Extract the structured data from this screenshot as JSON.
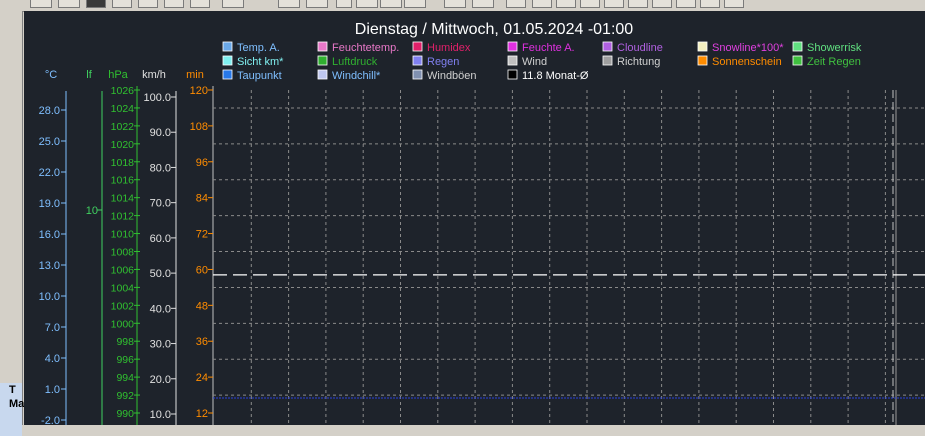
{
  "window": {
    "side_label_1": "T",
    "side_label_2": "Ma"
  },
  "toolbar": {
    "buttons": [
      "nav-first",
      "nav-prev",
      "record",
      "open",
      "table",
      "minus",
      "doc",
      "grid",
      "back",
      "forward",
      "new",
      "box1",
      "box2",
      "box3",
      "tbl1",
      "tbl2",
      "b1",
      "b2",
      "b3",
      "b4",
      "b5",
      "b6",
      "b7",
      "b8",
      "b9",
      "b10"
    ]
  },
  "chart_data": {
    "type": "line",
    "title": "Dienstag / Mittwoch, 01.05.2024  -01:00",
    "axes": [
      {
        "name": "°C",
        "color": "#7fbfff",
        "ticks": [
          "28.0",
          "25.0",
          "22.0",
          "19.0",
          "16.0",
          "13.0",
          "10.0",
          "7.0",
          "4.0",
          "1.0",
          "-2.0"
        ],
        "range": [
          -2.0,
          28.0
        ]
      },
      {
        "name": "lf",
        "color": "#40d060",
        "ticks": [
          "10"
        ]
      },
      {
        "name": "hPa",
        "color": "#30c030",
        "ticks": [
          "1026",
          "1024",
          "1022",
          "1020",
          "1018",
          "1016",
          "1014",
          "1012",
          "1010",
          "1008",
          "1006",
          "1004",
          "1002",
          "1000",
          "998",
          "996",
          "994",
          "992",
          "990"
        ],
        "range": [
          990,
          1026
        ]
      },
      {
        "name": "km/h",
        "color": "#e0e0e0",
        "ticks": [
          "100.0",
          "90.0",
          "80.0",
          "70.0",
          "60.0",
          "50.0",
          "40.0",
          "30.0",
          "20.0",
          "10.0"
        ],
        "range": [
          10,
          100
        ]
      },
      {
        "name": "min",
        "color": "#ff8c00",
        "ticks": [
          "120",
          "108",
          "96",
          "84",
          "72",
          "60",
          "48",
          "36",
          "24",
          "12"
        ],
        "range": [
          12,
          120
        ]
      }
    ],
    "legend": [
      {
        "label": "Temp. A.",
        "color": "#6aa8e8",
        "text_color": "#7fbfff"
      },
      {
        "label": "Feuchtetemp.",
        "color": "#e878c8",
        "text_color": "#e878c8"
      },
      {
        "label": "Humidex",
        "color": "#e0206a",
        "text_color": "#e0206a"
      },
      {
        "label": "Feuchte A.",
        "color": "#e030e0",
        "text_color": "#e030e0"
      },
      {
        "label": "Cloudline",
        "color": "#b060e0",
        "text_color": "#b060e0"
      },
      {
        "label": "Snowline*100*",
        "color": "#f4f0c0",
        "text_color": "#e040e0"
      },
      {
        "label": "Showerrisk",
        "color": "#60e080",
        "text_color": "#60e080"
      },
      {
        "label": "Sicht km*",
        "color": "#80f0f0",
        "text_color": "#80f0f0"
      },
      {
        "label": "Luftdruck",
        "color": "#30b030",
        "text_color": "#30b030"
      },
      {
        "label": "Regen",
        "color": "#8080f0",
        "text_color": "#8080f0"
      },
      {
        "label": "Wind",
        "color": "#c0c0c0",
        "text_color": "#d0d0d0"
      },
      {
        "label": "Richtung",
        "color": "#a0a0a0",
        "text_color": "#d0d0d0"
      },
      {
        "label": "Sonnenschein",
        "color": "#ff8c00",
        "text_color": "#ff8c00"
      },
      {
        "label": "Zeit Regen",
        "color": "#40c040",
        "text_color": "#40c040"
      },
      {
        "label": "Taupunkt",
        "color": "#2878e8",
        "text_color": "#7fbfff"
      },
      {
        "label": "Windchill*",
        "color": "#c0c8f0",
        "text_color": "#7fbfff"
      },
      {
        "label": "Windböen",
        "color": "#8090b0",
        "text_color": "#d0d0d0"
      },
      {
        "label": "11.8 Monat-Ø",
        "color": "#000000",
        "text_color": "#ffffff"
      }
    ],
    "series": [
      {
        "name": "11.8 Monat-Ø",
        "values": [
          11.8,
          11.8
        ]
      }
    ],
    "reference_line_kmh": 49.5,
    "blue_line_value": 11.8,
    "grid": true
  }
}
